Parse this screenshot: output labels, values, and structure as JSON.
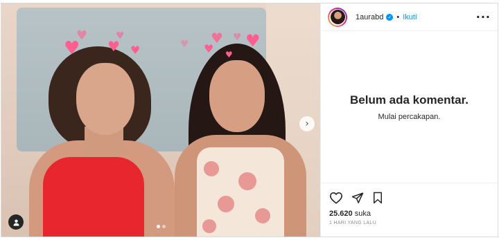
{
  "post": {
    "media": {
      "hearts": [
        "♥",
        "♥",
        "♥",
        "♥",
        "♥",
        "♥",
        "♥",
        "♥",
        "♥",
        "♥",
        "♥"
      ],
      "next_glyph": "›",
      "carousel_dots": 2,
      "active_dot": 0
    },
    "header": {
      "username": "1aurabd",
      "verified_glyph": "✓",
      "separator": "•",
      "follow_label": "Ikuti",
      "more_glyph": "···"
    },
    "comments": {
      "empty_title": "Belum ada komentar.",
      "empty_subtitle": "Mulai percakapan."
    },
    "footer": {
      "likes_count": "25.620",
      "likes_suffix": "suka",
      "timestamp": "1 HARI YANG LALU"
    },
    "colors": {
      "accent": "#0095f6",
      "text": "#262626",
      "muted": "#8e8e8e"
    },
    "icons": [
      "heart-icon",
      "share-icon",
      "bookmark-icon",
      "user-tag-icon",
      "chevron-right-icon",
      "more-icon",
      "verified-icon"
    ]
  }
}
